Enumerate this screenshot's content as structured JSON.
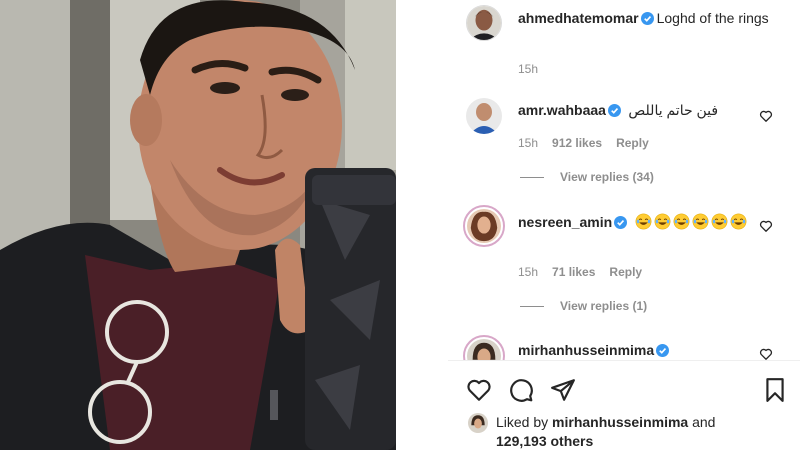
{
  "post": {
    "author": "ahmedhatemomar",
    "caption": "Loghd of the rings",
    "time": "15h"
  },
  "comments": [
    {
      "username": "amr.wahbaaa",
      "text": "فين حاتم ياللص",
      "time": "15h",
      "likes": "912 likes",
      "reply": "Reply",
      "view_replies": "View replies (34)"
    },
    {
      "username": "nesreen_amin",
      "emoji_count": 6,
      "time": "15h",
      "likes": "71 likes",
      "reply": "Reply",
      "view_replies": "View replies (1)"
    },
    {
      "username": "mirhanhusseinmima"
    }
  ],
  "actions": {
    "like": "heart-icon",
    "comment": "comment-icon",
    "share": "share-icon",
    "save": "bookmark-icon"
  },
  "liked_by": {
    "prefix": "Liked by",
    "user": "mirhanhusseinmima",
    "and": "and",
    "others": "129,193 others"
  },
  "colors": {
    "verified": "#3897f0",
    "text": "#262626",
    "muted": "#8e8e8e"
  }
}
